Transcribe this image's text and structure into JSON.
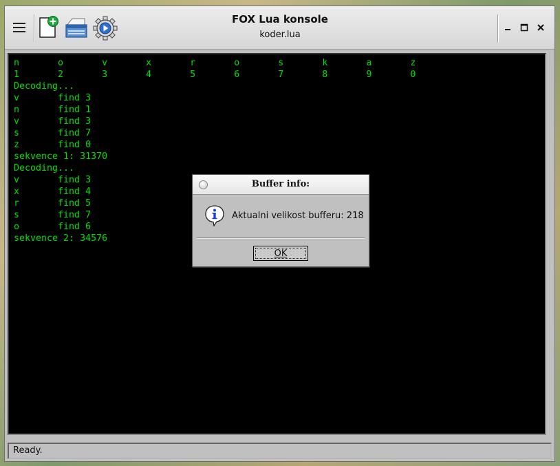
{
  "window": {
    "title": "FOX Lua konsole",
    "subtitle": "koder.lua",
    "controls": {
      "minimize": "–",
      "maximize": "□",
      "close": "✕"
    }
  },
  "toolbar": {
    "icons": [
      "menu-icon",
      "new-file-icon",
      "save-icon",
      "run-gear-icon"
    ]
  },
  "console": {
    "lines": [
      "n       o       v       x       r       o       s       k       a       z",
      "1       2       3       4       5       6       7       8       9       0",
      "Decoding...",
      "v       find 3",
      "n       find 1",
      "v       find 3",
      "s       find 7",
      "z       find 0",
      "sekvence 1: 31370",
      "Decoding...",
      "v       find 3",
      "x       find 4",
      "r       find 5",
      "s       find 7",
      "o       find 6",
      "sekvence 2: 34576"
    ],
    "text_color": "#00e000",
    "background": "#000000"
  },
  "status": {
    "text": "Ready."
  },
  "dialog": {
    "title": "Buffer info:",
    "message": "Aktualni velikost bufferu: 218",
    "icon": "info-icon",
    "ok_label": "OK"
  }
}
